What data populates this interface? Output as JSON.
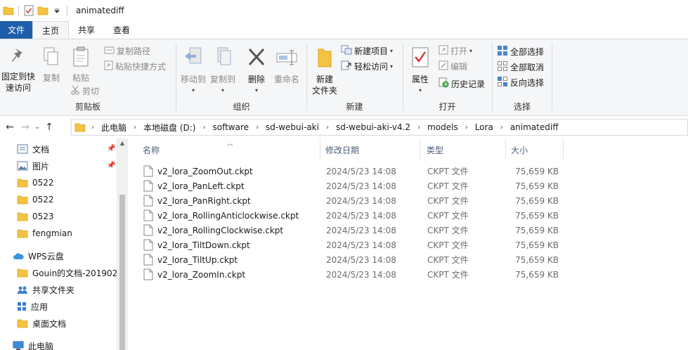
{
  "window": {
    "title": "animatediff"
  },
  "ribbon_tabs": [
    "文件",
    "主页",
    "共享",
    "查看"
  ],
  "ribbon": {
    "clipboard": {
      "label": "剪贴板",
      "pin_quick_access": "固定到快\n速访问",
      "copy": "复制",
      "paste": "粘贴",
      "copy_path": "复制路径",
      "paste_shortcut": "粘贴快捷方式",
      "cut": "剪切"
    },
    "organize": {
      "label": "组织",
      "move_to": "移动到",
      "copy_to": "复制到",
      "delete": "删除",
      "rename": "重命名"
    },
    "new": {
      "label": "新建",
      "new_folder": "新建\n文件夹",
      "new_item": "新建项目",
      "easy_access": "轻松访问"
    },
    "open": {
      "label": "打开",
      "properties": "属性",
      "open": "打开",
      "edit": "编辑",
      "history": "历史记录"
    },
    "select": {
      "label": "选择",
      "select_all": "全部选择",
      "select_none": "全部取消",
      "invert": "反向选择"
    }
  },
  "breadcrumb": [
    "此电脑",
    "本地磁盘 (D:)",
    "software",
    "sd-webui-aki",
    "sd-webui-aki-v4.2",
    "models",
    "Lora",
    "animatediff"
  ],
  "nav_pane": {
    "items": [
      {
        "label": "文档",
        "icon": "documents-icon",
        "pinned": true
      },
      {
        "label": "图片",
        "icon": "pictures-icon",
        "pinned": true
      },
      {
        "label": "0522",
        "icon": "folder-icon",
        "pinned": false
      },
      {
        "label": "0522",
        "icon": "folder-icon",
        "pinned": false
      },
      {
        "label": "0523",
        "icon": "folder-icon",
        "pinned": false
      },
      {
        "label": "fengmian",
        "icon": "folder-icon",
        "pinned": false
      },
      {
        "label": "WPS云盘",
        "icon": "cloud-icon",
        "pinned": false
      },
      {
        "label": "Gouin的文档-201902",
        "icon": "folder-icon",
        "pinned": false
      },
      {
        "label": "共享文件夹",
        "icon": "shared-folder-icon",
        "pinned": false
      },
      {
        "label": "应用",
        "icon": "apps-icon",
        "pinned": false
      },
      {
        "label": "桌面文档",
        "icon": "folder-icon",
        "pinned": false
      },
      {
        "label": "此电脑",
        "icon": "computer-icon",
        "pinned": false
      }
    ]
  },
  "columns": {
    "name": "名称",
    "date": "修改日期",
    "type": "类型",
    "size": "大小"
  },
  "files": [
    {
      "name": "v2_lora_ZoomOut.ckpt",
      "date": "2024/5/23 14:08",
      "type": "CKPT 文件",
      "size": "75,659 KB"
    },
    {
      "name": "v2_lora_PanLeft.ckpt",
      "date": "2024/5/23 14:08",
      "type": "CKPT 文件",
      "size": "75,659 KB"
    },
    {
      "name": "v2_lora_PanRight.ckpt",
      "date": "2024/5/23 14:08",
      "type": "CKPT 文件",
      "size": "75,659 KB"
    },
    {
      "name": "v2_lora_RollingAnticlockwise.ckpt",
      "date": "2024/5/23 14:08",
      "type": "CKPT 文件",
      "size": "75,659 KB"
    },
    {
      "name": "v2_lora_RollingClockwise.ckpt",
      "date": "2024/5/23 14:08",
      "type": "CKPT 文件",
      "size": "75,659 KB"
    },
    {
      "name": "v2_lora_TiltDown.ckpt",
      "date": "2024/5/23 14:08",
      "type": "CKPT 文件",
      "size": "75,659 KB"
    },
    {
      "name": "v2_lora_TiltUp.ckpt",
      "date": "2024/5/23 14:08",
      "type": "CKPT 文件",
      "size": "75,659 KB"
    },
    {
      "name": "v2_lora_ZoomIn.ckpt",
      "date": "2024/5/23 14:08",
      "type": "CKPT 文件",
      "size": "75,659 KB"
    }
  ],
  "colors": {
    "file_tab": "#1e5ea8",
    "folder": "#f5c342",
    "ribbon_bg": "#f5f6f7",
    "header_text": "#4c607a"
  }
}
